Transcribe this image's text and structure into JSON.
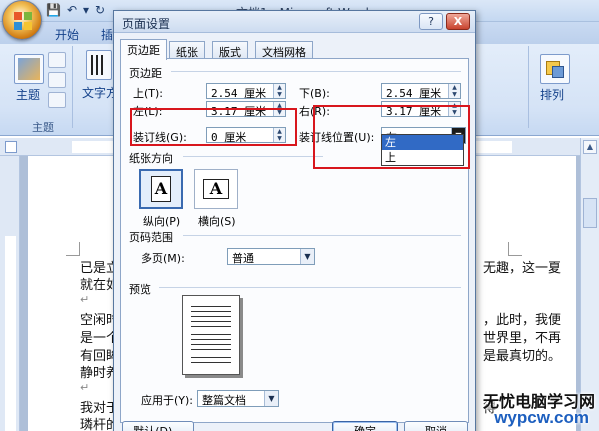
{
  "window": {
    "title": "文档1 - Microsoft Word",
    "tabs": [
      "开始",
      "插入"
    ],
    "ribbon": {
      "theme_label": "主题",
      "theme_group_label": "主题",
      "text_dir_label": "文字方向",
      "arrange_label": "排列"
    },
    "document_lines": [
      "已是立",
      "就在如",
      "空闲时",
      "是一个",
      "有回眸",
      "静时养",
      "我对于",
      "璘杆的"
    ],
    "document_right_lines": [
      "无趣，这一夏",
      "，此时，我便",
      "世界里，不再",
      "是最真切的。",
      "得"
    ]
  },
  "dialog": {
    "title": "页面设置",
    "help_icon": "?",
    "close_icon": "X",
    "tabs": [
      "页边距",
      "纸张",
      "版式",
      "文档网格"
    ],
    "active_tab": "页边距",
    "margins": {
      "section_label": "页边距",
      "top_label": "上(T):",
      "top_value": "2.54 厘米",
      "bottom_label": "下(B):",
      "bottom_value": "2.54 厘米",
      "left_label": "左(L):",
      "left_value": "3.17 厘米",
      "right_label": "右(R):",
      "right_value": "3.17 厘米",
      "gutter_label": "装订线(G):",
      "gutter_value": "0 厘米",
      "gutter_pos_label": "装订线位置(U):",
      "gutter_pos_value": "左",
      "gutter_pos_options": [
        "左",
        "上"
      ]
    },
    "orientation": {
      "section_label": "纸张方向",
      "portrait_label": "纵向(P)",
      "landscape_label": "横向(S)",
      "glyph": "A"
    },
    "pages": {
      "section_label": "页码范围",
      "multiple_label": "多页(M):",
      "multiple_value": "普通"
    },
    "preview": {
      "section_label": "预览",
      "apply_label": "应用于(Y):",
      "apply_value": "整篇文档"
    },
    "buttons": {
      "default": "默认(D)...",
      "ok": "确定",
      "cancel": "取消"
    }
  },
  "watermark": {
    "line1": "无忧电脑学习网",
    "line2": "wypcw.com"
  },
  "colors": {
    "highlight_box": "#d8161d",
    "selection": "#316ac5",
    "watermark_blue": "#1d5fbf"
  }
}
